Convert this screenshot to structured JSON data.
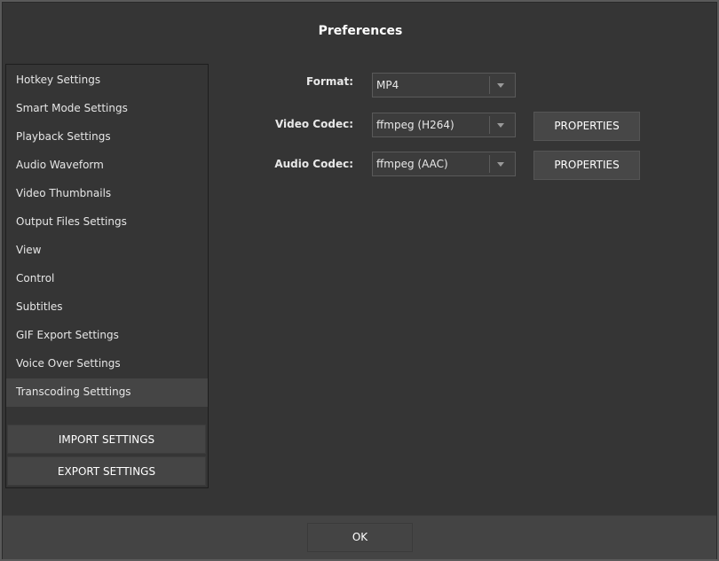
{
  "dialog": {
    "title": "Preferences"
  },
  "sidebar": {
    "items": [
      {
        "label": "Hotkey Settings"
      },
      {
        "label": "Smart Mode Settings"
      },
      {
        "label": "Playback Settings"
      },
      {
        "label": "Audio Waveform"
      },
      {
        "label": "Video Thumbnails"
      },
      {
        "label": "Output Files Settings"
      },
      {
        "label": "View"
      },
      {
        "label": "Control"
      },
      {
        "label": "Subtitles"
      },
      {
        "label": "GIF Export Settings"
      },
      {
        "label": "Voice Over Settings"
      },
      {
        "label": "Transcoding Setttings"
      }
    ],
    "active_index": 11,
    "import_label": "IMPORT SETTINGS",
    "export_label": "EXPORT SETTINGS"
  },
  "transcoding": {
    "format": {
      "label": "Format:",
      "value": "MP4"
    },
    "video_codec": {
      "label": "Video Codec:",
      "value": "ffmpeg (H264)",
      "properties_label": "PROPERTIES"
    },
    "audio_codec": {
      "label": "Audio Codec:",
      "value": "ffmpeg (AAC)",
      "properties_label": "PROPERTIES"
    }
  },
  "footer": {
    "ok_label": "OK"
  },
  "colors": {
    "background": "#353535",
    "active_item": "#454545",
    "footer": "#444444"
  },
  "icons": {
    "dropdown": "chevron-down-icon"
  }
}
